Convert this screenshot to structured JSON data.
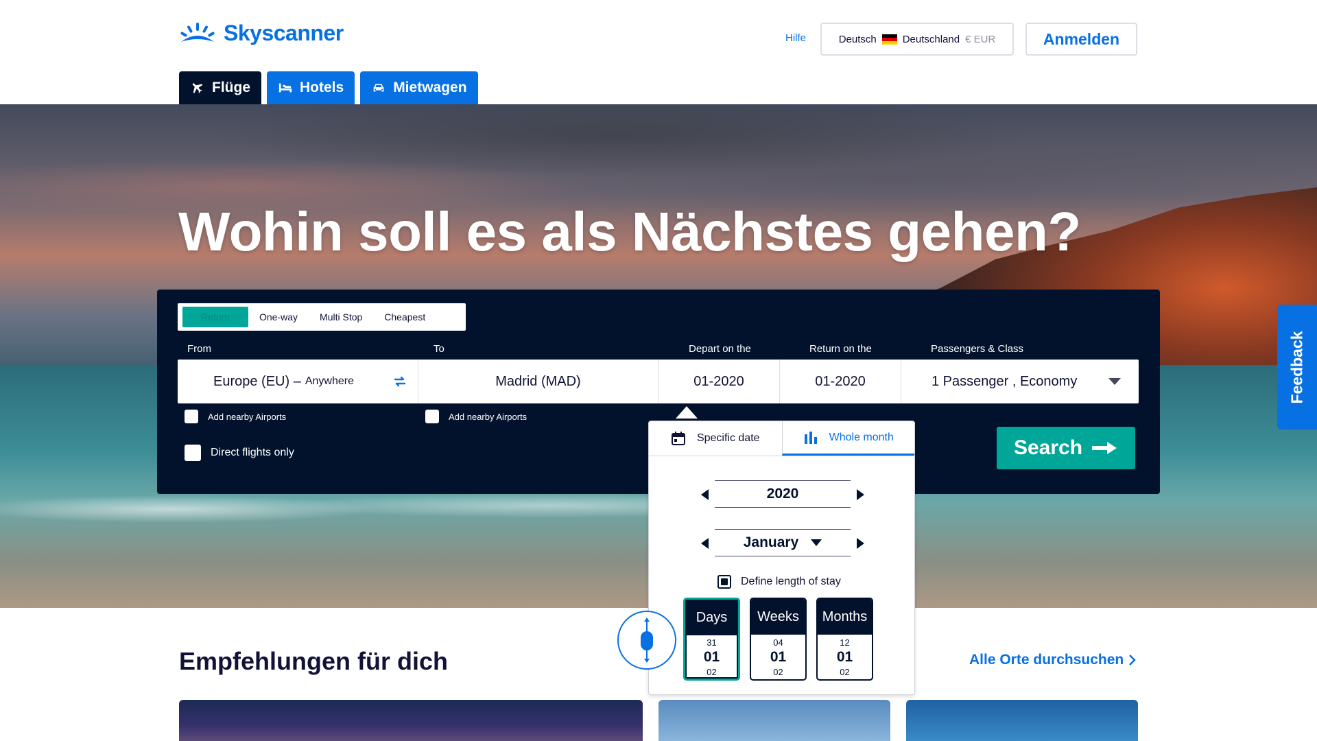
{
  "header": {
    "logo_text": "Skyscanner",
    "help_label": "Hilfe",
    "locale": {
      "language": "Deutsch",
      "country": "Deutschland",
      "currency": "€ EUR"
    },
    "signin_label": "Anmelden"
  },
  "nav_tabs": [
    {
      "label": "Flüge",
      "icon": "plane-icon",
      "active": true
    },
    {
      "label": "Hotels",
      "icon": "bed-icon",
      "active": false
    },
    {
      "label": "Mietwagen",
      "icon": "car-icon",
      "active": false
    }
  ],
  "hero": {
    "title": "Wohin soll es als Nächstes gehen?"
  },
  "search": {
    "trip_types": [
      "Return",
      "One-way",
      "Multi Stop",
      "Cheapest"
    ],
    "active_trip_type": "Return",
    "labels": {
      "from": "From",
      "to": "To",
      "depart": "Depart on the",
      "return": "Return on the",
      "passengers": "Passengers & Class"
    },
    "from_value": "Europe (EU) –",
    "from_value_small": "Anywhere",
    "to_value": "Madrid (MAD)",
    "depart_value": "01-2020",
    "return_value": "01-2020",
    "passengers_value": "1 Passenger , Economy",
    "nearby_airports_label": "Add nearby Airports",
    "direct_flights_label": "Direct flights only",
    "search_button": "Search"
  },
  "date_popover": {
    "tabs": [
      {
        "label": "Specific date",
        "icon": "calendar-icon",
        "active": false
      },
      {
        "label": "Whole month",
        "icon": "bar-chart-icon",
        "active": true
      }
    ],
    "year": "2020",
    "month": "January",
    "stay_label": "Define length of stay",
    "durations": [
      {
        "label": "Days",
        "prev": "31",
        "current": "01",
        "next": "02",
        "active": true
      },
      {
        "label": "Weeks",
        "prev": "04",
        "current": "01",
        "next": "02",
        "active": false
      },
      {
        "label": "Months",
        "prev": "12",
        "current": "01",
        "next": "02",
        "active": false
      }
    ]
  },
  "feedback_label": "Feedback",
  "recommendations": {
    "title": "Empfehlungen für dich",
    "link": "Alle Orte durchsuchen"
  },
  "colors": {
    "brand_blue": "#0770e3",
    "navy": "#02122c",
    "teal": "#00a698"
  }
}
